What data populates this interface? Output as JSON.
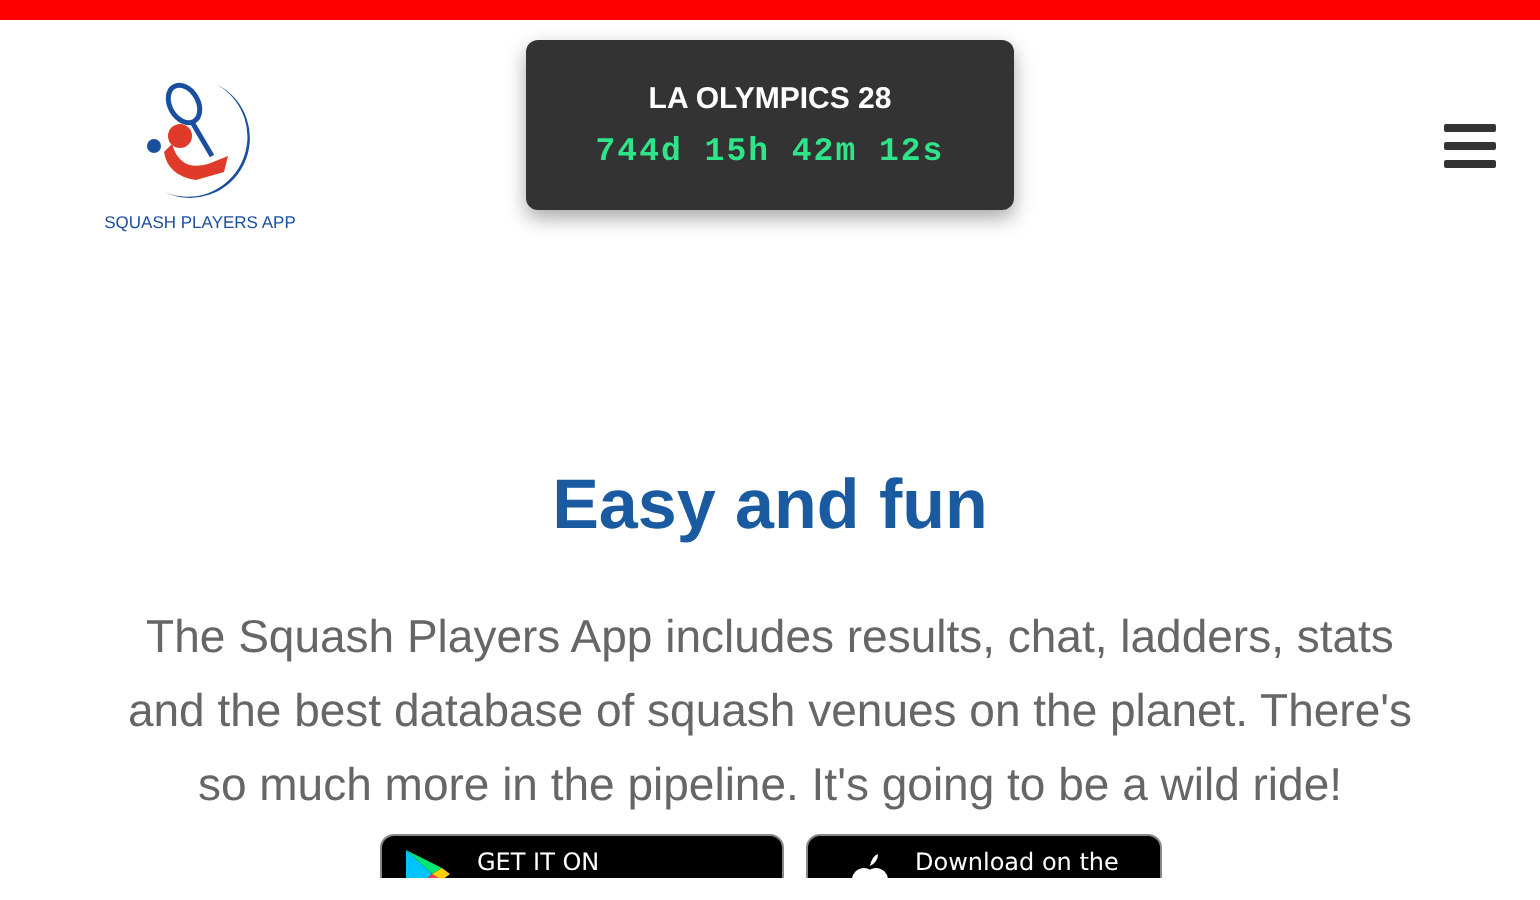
{
  "logo": {
    "text": "SQUASH PLAYERS APP"
  },
  "countdown": {
    "title": "LA OLYMPICS 28",
    "time": "744d 15h 42m 12s"
  },
  "hero": {
    "heading": "Easy and fun",
    "text": "The Squash Players App includes results, chat, ladders, stats and the best database of squash venues on the planet. There's so much more in the pipeline. It's going to be a wild ride!"
  },
  "store_buttons": [
    {
      "kind": "google",
      "label": "GET IT ON"
    },
    {
      "kind": "apple",
      "label": "Download on the"
    }
  ]
}
